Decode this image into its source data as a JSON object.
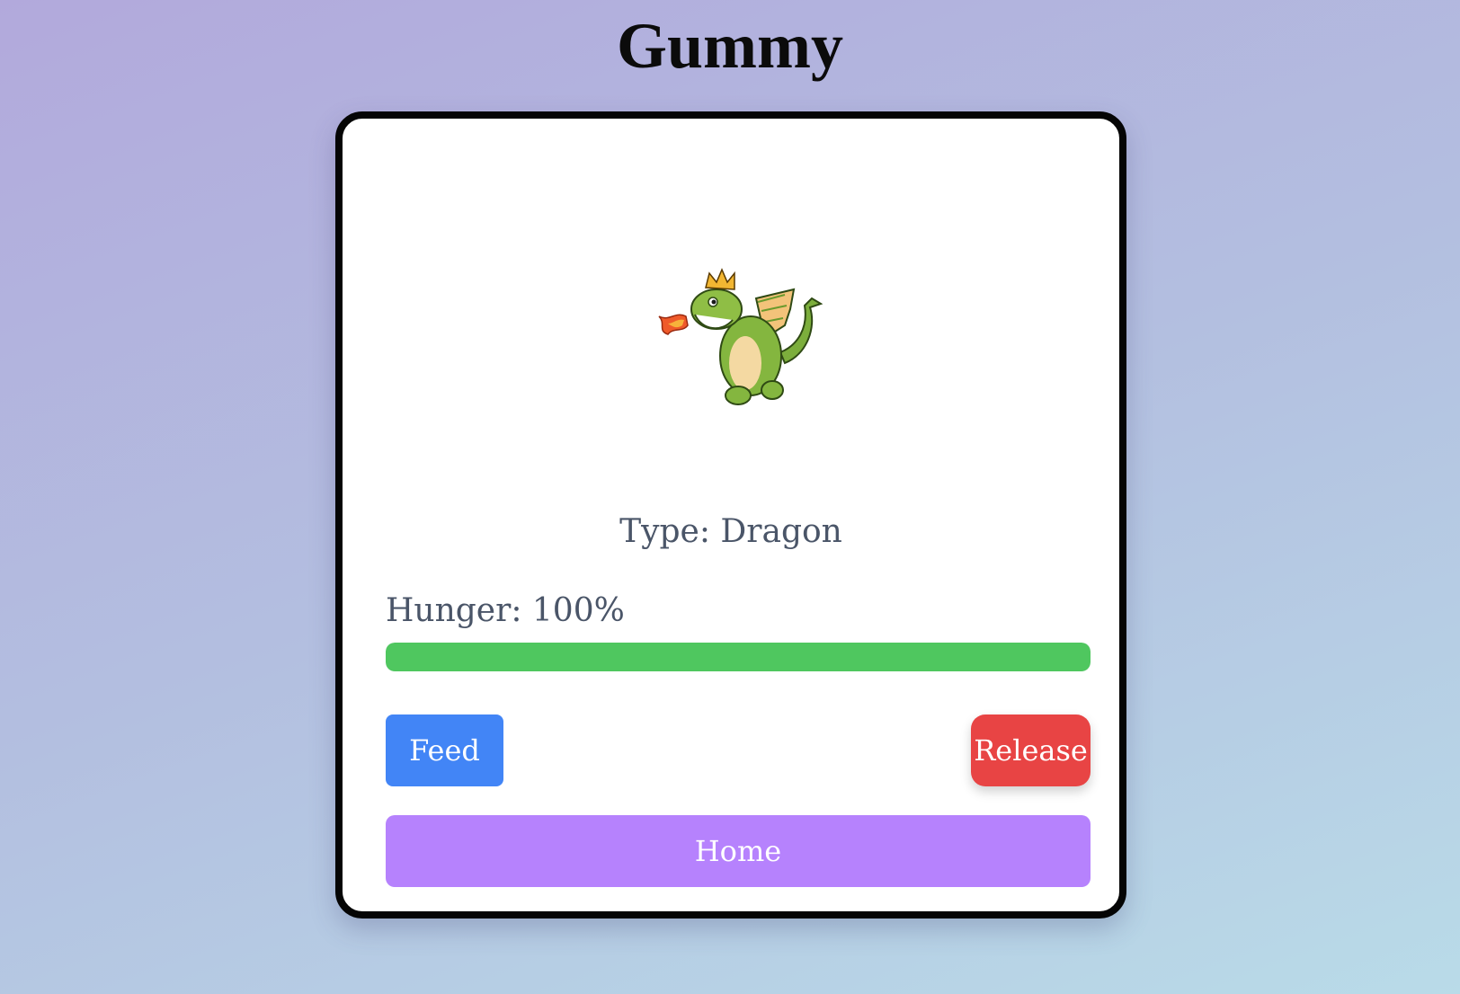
{
  "app": {
    "title": "Gummy"
  },
  "pet": {
    "image_alt": "dragon-illustration",
    "type_text": "Type: Dragon",
    "hunger_text": "Hunger: 100%",
    "hunger_percent": 100
  },
  "actions": {
    "feed_label": "Feed",
    "release_label": "Release",
    "home_label": "Home"
  },
  "colors": {
    "feed": "#4285f6",
    "release": "#e84444",
    "home": "#b682fd",
    "hunger_bar": "#4fc75f",
    "text": "#4a5568"
  }
}
